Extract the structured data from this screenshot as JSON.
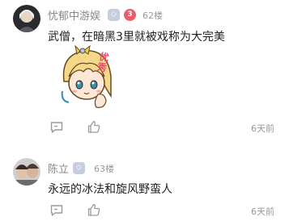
{
  "comments": [
    {
      "username": "忧郁中游娱",
      "level_badge": "",
      "level_number": "3",
      "floor": "62楼",
      "content": "武僧，在暗黑3里就被戏称为大完美",
      "sticker_text": "优秀",
      "time": "6天前"
    },
    {
      "username": "陈立",
      "level_badge": "",
      "floor": "63楼",
      "content": "永远的冰法和旋风野蛮人",
      "time": "6天前"
    }
  ],
  "colors": {
    "username": "#888888",
    "meta": "#999999",
    "text": "#222222",
    "badge": "#c6cede",
    "level_red": "#ef5c6a"
  },
  "icons": {
    "reply": "comment-icon",
    "like": "thumbs-up-icon"
  }
}
